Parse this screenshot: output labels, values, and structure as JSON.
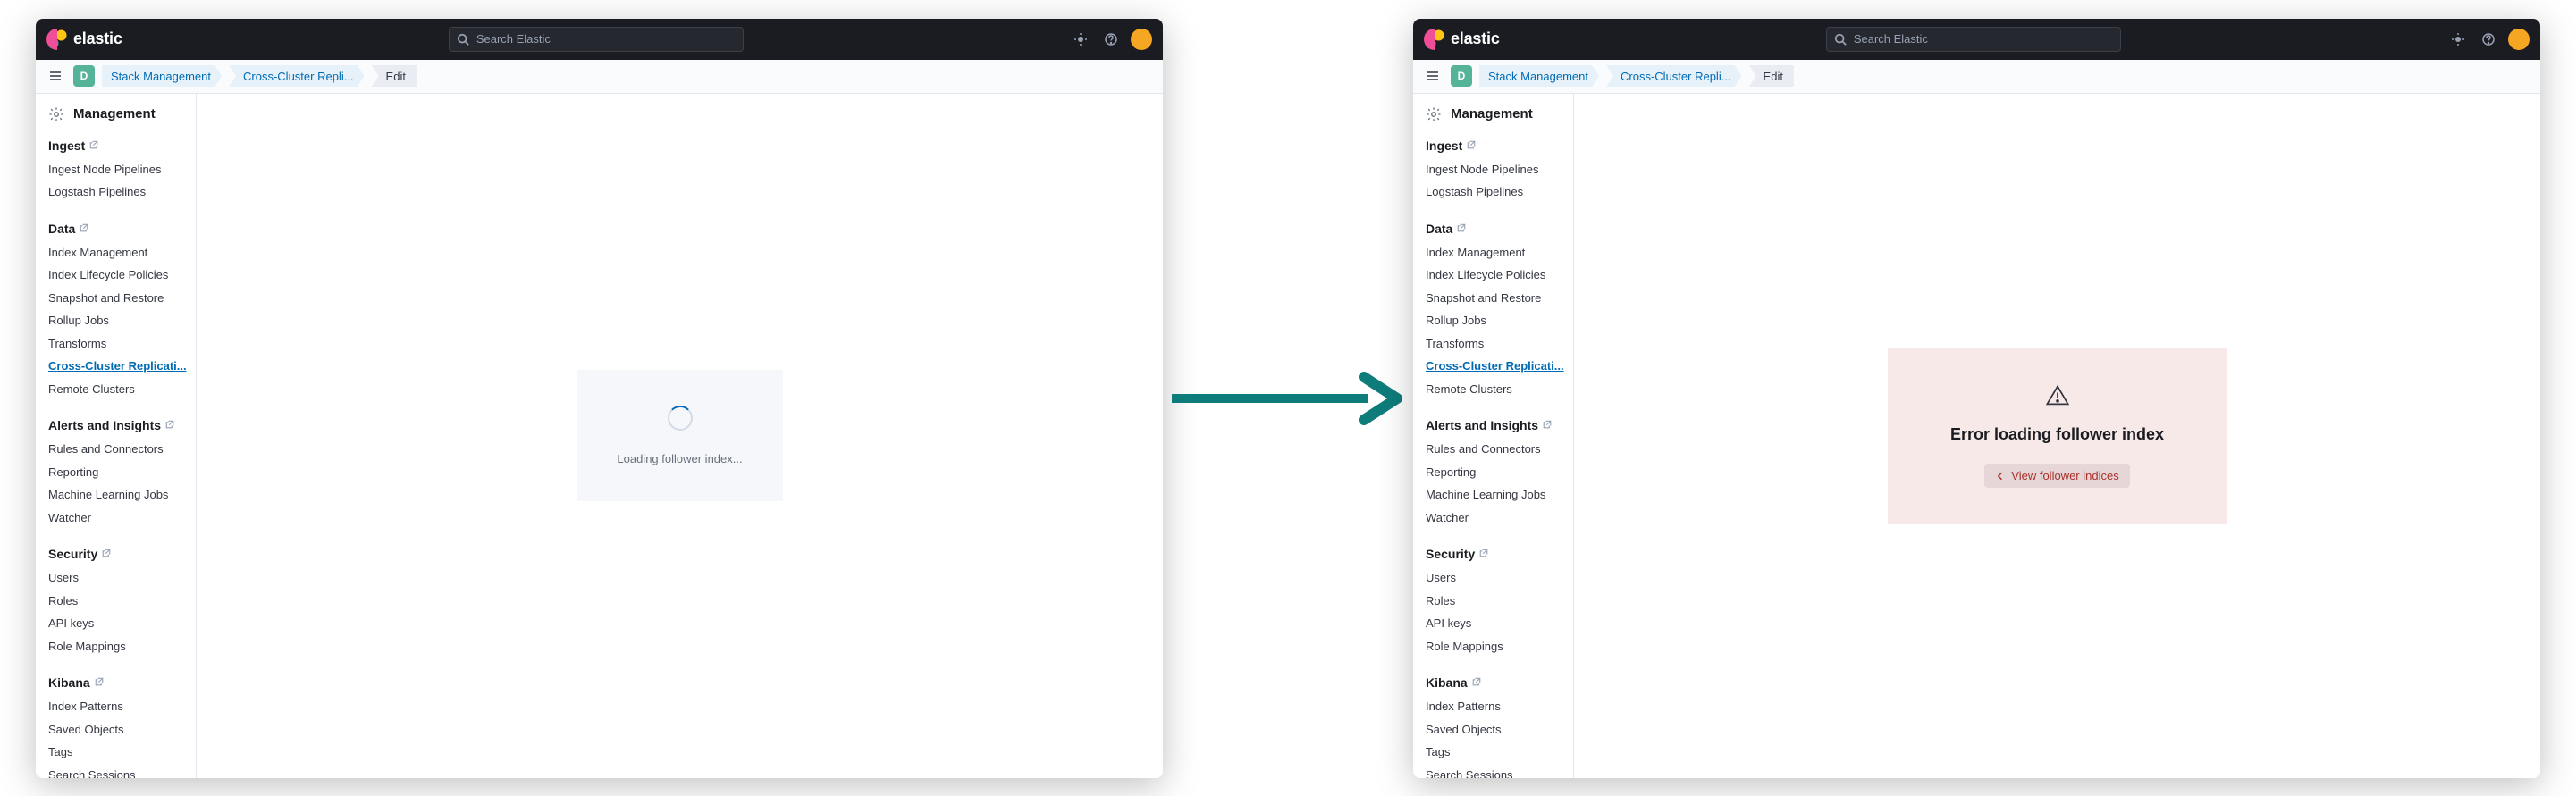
{
  "brand": "elastic",
  "search_placeholder": "Search Elastic",
  "space_initial": "D",
  "breadcrumbs": {
    "stack_management": "Stack Management",
    "ccr": "Cross-Cluster Repli...",
    "edit": "Edit"
  },
  "sidebar": {
    "title": "Management",
    "sections": [
      {
        "title": "Ingest",
        "items": [
          "Ingest Node Pipelines",
          "Logstash Pipelines"
        ]
      },
      {
        "title": "Data",
        "items": [
          "Index Management",
          "Index Lifecycle Policies",
          "Snapshot and Restore",
          "Rollup Jobs",
          "Transforms",
          "Cross-Cluster Replicati...",
          "Remote Clusters"
        ],
        "active": 5
      },
      {
        "title": "Alerts and Insights",
        "items": [
          "Rules and Connectors",
          "Reporting",
          "Machine Learning Jobs",
          "Watcher"
        ]
      },
      {
        "title": "Security",
        "items": [
          "Users",
          "Roles",
          "API keys",
          "Role Mappings"
        ]
      },
      {
        "title": "Kibana",
        "items": [
          "Index Patterns",
          "Saved Objects",
          "Tags",
          "Search Sessions"
        ]
      }
    ]
  },
  "loading_message": "Loading follower index...",
  "error": {
    "title": "Error loading follower index",
    "button": "View follower indices"
  }
}
